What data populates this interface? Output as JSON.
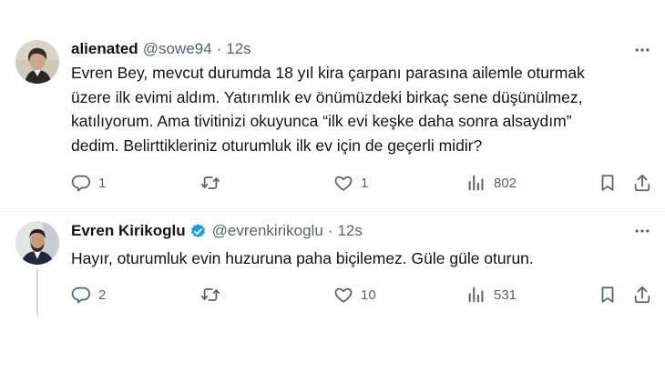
{
  "tweets": [
    {
      "name": "alienated",
      "handle": "@sowe94",
      "separator": "·",
      "time": "12s",
      "text": "Evren Bey, mevcut durumda 18 yıl kira çarpanı parasına ailemle oturmak\nüzere ilk evimi aldım. Yatırımlık ev önümüzdeki birkaç sene düşünülmez,\nkatılıyorum. Ama tivitinizi okuyunca “ilk evi keşke daha sonra alsaydım”\ndedim. Belirttikleriniz oturumluk ilk ev için de geçerli midir?",
      "replies": "1",
      "retweets": "",
      "likes": "1",
      "views": "802"
    },
    {
      "name": "Evren Kirikoglu",
      "verified": true,
      "handle": "@evrenkirikoglu",
      "separator": "·",
      "time": "12s",
      "text": "Hayır, oturumluk evin huzuruna paha biçilemez. Güle güle oturun.",
      "replies": "2",
      "retweets": "",
      "likes": "10",
      "views": "531"
    }
  ],
  "icons": {
    "more": "more-icon",
    "reply": "reply-icon",
    "retweet": "retweet-icon",
    "like": "like-icon",
    "views": "views-icon",
    "bookmark": "bookmark-icon",
    "share": "share-icon",
    "verified": "verified-icon"
  },
  "colors": {
    "text": "#0f1419",
    "secondary": "#536471",
    "verified": "#1d9bf0",
    "divider": "#eff3f4"
  }
}
